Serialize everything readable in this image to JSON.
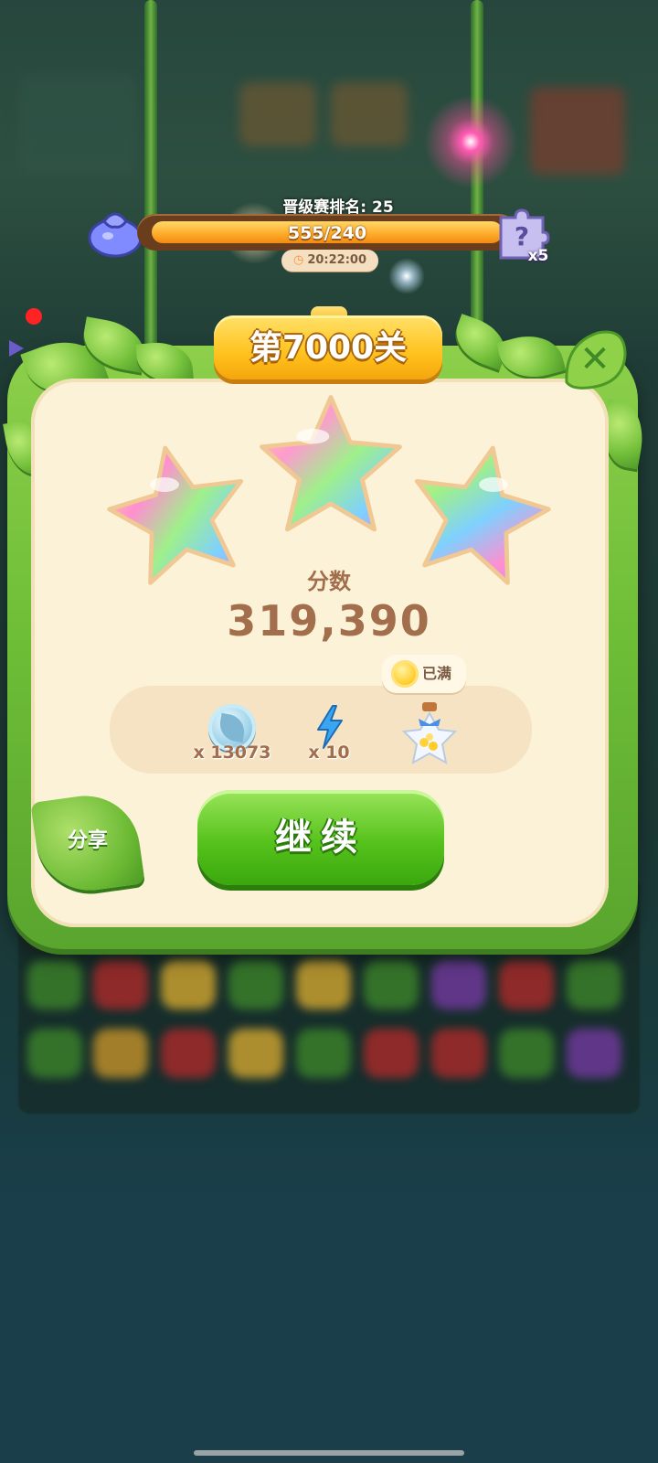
{
  "hud": {
    "rank_label": "晋级赛排名: 25",
    "progress_text": "555/240",
    "progress_fraction": 1.0,
    "timer": "20:22:00",
    "timer_icon": "alarm-clock-icon",
    "bag_icon": "purple-bag-icon",
    "puzzle_icon": "mystery-puzzle-icon",
    "puzzle_count": "x5"
  },
  "dialog": {
    "level_title": "第7000关",
    "close_icon": "close-icon",
    "stars_earned": 3,
    "stars_total": 3,
    "score_label": "分数",
    "score_value": "319,390",
    "rewards": [
      {
        "icon": "leaf-coin-icon",
        "count": "x 13073"
      },
      {
        "icon": "lightning-bolt-icon",
        "count": "x 10"
      },
      {
        "icon": "star-jar-icon",
        "count": ""
      }
    ],
    "full_badge": "已满",
    "continue_label": "继续",
    "share_label": "分享"
  },
  "colors": {
    "panel_green": "#6dbd37",
    "panel_cream": "#fcf2d8",
    "score_brown": "#a26e4c",
    "progress_orange": "#ffae2e",
    "banner_gold": "#ffc21d",
    "button_green": "#56c21c"
  }
}
